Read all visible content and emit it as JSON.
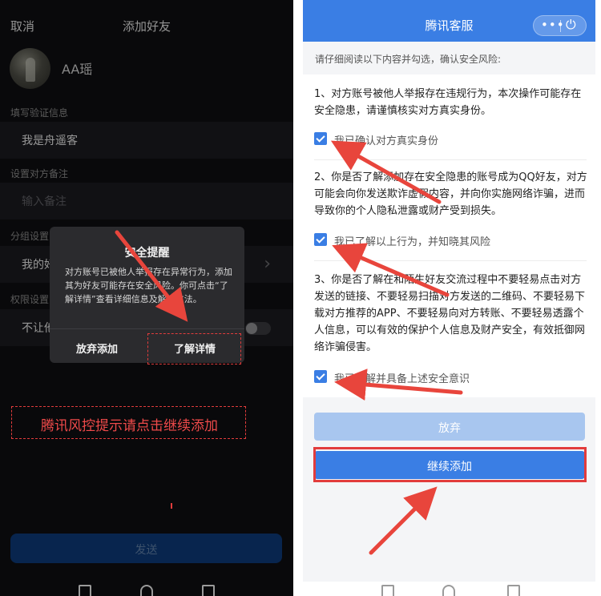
{
  "left": {
    "cancel_label": "取消",
    "title": "添加好友",
    "user_name": "AA瑶",
    "verify_label": "填写验证信息",
    "verify_value": "我是舟遥客",
    "remark_label": "设置对方备注",
    "remark_placeholder": "输入备注",
    "group_label": "分组设置",
    "group_value": "我的好",
    "permission_label": "权限设置",
    "permission_value": "不让他",
    "send_label": "发送",
    "risk_hint": "腾讯风控提示请点击继续添加",
    "dialog": {
      "title": "安全提醒",
      "body": "对方账号已被他人举报存在异常行为，添加其为好友可能存在安全风险。你可点击“了解详情”查看详细信息及解决方法。",
      "giveup_label": "放弃添加",
      "detail_label": "了解详情"
    }
  },
  "right": {
    "title": "腾讯客服",
    "menu_icon": "more-dots-icon",
    "close_icon": "power-icon",
    "intro": "请仔细阅读以下内容并勾选，确认安全风险:",
    "items": [
      {
        "text": "1、对方账号被他人举报存在违规行为，本次操作可能存在安全隐患，请谨慎核实对方真实身份。",
        "check_label": "我已确认对方真实身份",
        "checked": true
      },
      {
        "text": "2、你是否了解添加存在安全隐患的账号成为QQ好友，对方可能会向你发送欺诈虚假内容，并向你实施网络诈骗，进而导致你的个人隐私泄露或财产受到损失。",
        "check_label": "我已了解以上行为，并知晓其风险",
        "checked": true
      },
      {
        "text": "3、你是否了解在和陌生好友交流过程中不要轻易点击对方发送的链接、不要轻易扫描对方发送的二维码、不要轻易下载对方推荐的APP、不要轻易向对方转账、不要轻易透露个人信息，可以有效的保护个人信息及财产安全，有效抵御网络诈骗侵害。",
        "check_label": "我已了解并具备上述安全意识",
        "checked": true
      }
    ],
    "abandon_label": "放弃",
    "continue_label": "继续添加"
  },
  "colors": {
    "accent_blue": "#3a7ee4",
    "annotation_red": "#e23c3c",
    "dark_bg": "#0f0f11"
  }
}
